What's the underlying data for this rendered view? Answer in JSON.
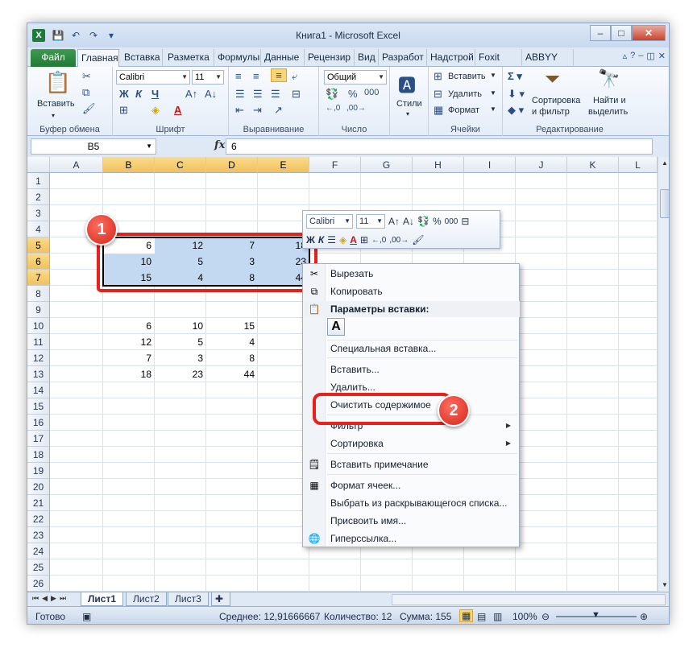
{
  "window": {
    "title": "Книга1 - Microsoft Excel",
    "app_icon": "X",
    "controls": [
      "–",
      "□",
      "✕"
    ]
  },
  "ribbon_tabs": [
    {
      "label": "Файл",
      "kind": "file"
    },
    {
      "label": "Главная",
      "active": true
    },
    {
      "label": "Вставка"
    },
    {
      "label": "Разметка"
    },
    {
      "label": "Формулы"
    },
    {
      "label": "Данные"
    },
    {
      "label": "Рецензир"
    },
    {
      "label": "Вид"
    },
    {
      "label": "Разработ"
    },
    {
      "label": "Надстрой"
    },
    {
      "label": "Foxit PDF"
    },
    {
      "label": "ABBYY PD"
    }
  ],
  "ribbon": {
    "clipboard": {
      "label": "Буфер обмена",
      "paste": "Вставить"
    },
    "font": {
      "label": "Шрифт",
      "name": "Calibri",
      "size": "11"
    },
    "alignment": {
      "label": "Выравнивание"
    },
    "number": {
      "label": "Число",
      "format": "Общий"
    },
    "styles": {
      "button": "Стили"
    },
    "cells": {
      "label": "Ячейки",
      "insert": "Вставить",
      "delete": "Удалить",
      "format": "Формат"
    },
    "editing": {
      "label": "Редактирование",
      "sort_line1": "Сортировка",
      "sort_line2": "и фильтр",
      "find_line1": "Найти и",
      "find_line2": "выделить"
    }
  },
  "formula_bar": {
    "name_box": "B5",
    "fx": "fx",
    "value": "6"
  },
  "columns": [
    "A",
    "B",
    "C",
    "D",
    "E",
    "F",
    "G",
    "H",
    "I",
    "J",
    "K",
    "L"
  ],
  "rows": [
    "1",
    "2",
    "3",
    "4",
    "5",
    "6",
    "7",
    "8",
    "9",
    "10",
    "11",
    "12",
    "13",
    "14",
    "15",
    "16",
    "17",
    "18",
    "19",
    "20",
    "21",
    "22",
    "23",
    "24",
    "25",
    "26"
  ],
  "cells": {
    "r5": [
      "6",
      "12",
      "7",
      "18"
    ],
    "r6": [
      "10",
      "5",
      "3",
      "23"
    ],
    "r7": [
      "15",
      "4",
      "8",
      "44"
    ],
    "r10": [
      "6",
      "10",
      "15"
    ],
    "r11": [
      "12",
      "5",
      "4"
    ],
    "r12": [
      "7",
      "3",
      "8"
    ],
    "r13": [
      "18",
      "23",
      "44"
    ]
  },
  "mini_toolbar": {
    "font": "Calibri",
    "size": "11"
  },
  "context_menu": {
    "cut": "Вырезать",
    "copy": "Копировать",
    "paste_options": "Параметры вставки:",
    "paste_special": "Специальная вставка...",
    "insert": "Вставить...",
    "delete": "Удалить...",
    "clear": "Очистить содержимое",
    "filter": "Фильтр",
    "sort": "Сортировка",
    "insert_comment": "Вставить примечание",
    "format_cells": "Формат ячеек...",
    "pick_list": "Выбрать из раскрывающегося списка...",
    "define_name": "Присвоить имя...",
    "hyperlink": "Гиперссылка..."
  },
  "annotations": {
    "badge1": "1",
    "badge2": "2"
  },
  "sheets": [
    "Лист1",
    "Лист2",
    "Лист3"
  ],
  "status": {
    "ready": "Готово",
    "average": "Среднее: 12,91666667",
    "count": "Количество: 12",
    "sum": "Сумма: 155",
    "zoom": "100%"
  },
  "colors": {
    "accent_red": "#e8211a",
    "selection": "#c2d9f1",
    "file_tab": "#1f7b35"
  }
}
